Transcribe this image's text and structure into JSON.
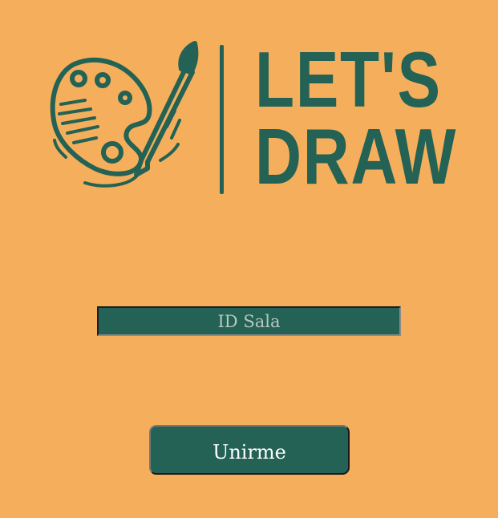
{
  "logo": {
    "line1": "LET'S",
    "line2": "DRAW",
    "icon": "palette-brush-icon",
    "color": "#236254"
  },
  "room_field": {
    "placeholder": "ID Sala",
    "value": ""
  },
  "join_button": {
    "label": "Unirme"
  },
  "colors": {
    "background": "#F5AF5C",
    "accent": "#236254"
  }
}
